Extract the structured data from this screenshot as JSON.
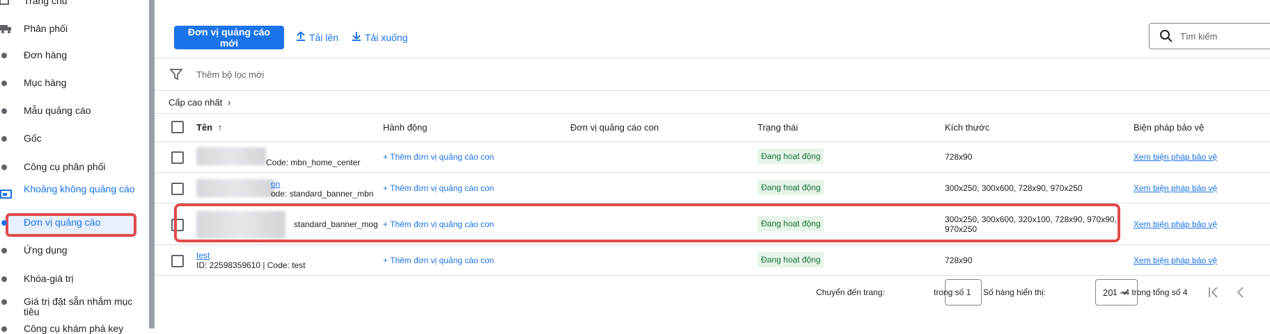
{
  "sidebar": {
    "items": [
      {
        "label": "Trang chủ",
        "icon": "home-icon"
      },
      {
        "label": "Phân phối",
        "icon": "truck-icon"
      },
      {
        "label": "Đơn hàng",
        "icon": "bullet-icon"
      },
      {
        "label": "Mục hàng",
        "icon": "bullet-icon"
      },
      {
        "label": "Mẫu quảng cáo",
        "icon": "bullet-icon"
      },
      {
        "label": "Gốc",
        "icon": "bullet-icon"
      },
      {
        "label": "Công cụ phân phối",
        "icon": "bullet-icon"
      },
      {
        "label": "Khoảng không quảng cáo",
        "icon": "inventory-icon"
      },
      {
        "label": "Đơn vị quảng cáo",
        "icon": "bullet-icon"
      },
      {
        "label": "Ứng dụng",
        "icon": "bullet-icon"
      },
      {
        "label": "Khóa-giá trị",
        "icon": "bullet-icon"
      },
      {
        "label": "Giá trị đặt sẵn nhắm mục tiêu",
        "icon": "bullet-icon"
      },
      {
        "label": "Công cụ khám phá key",
        "icon": "bullet-icon"
      }
    ]
  },
  "toolbar": {
    "new_label": "Đơn vị quảng cáo mới",
    "upload_label": "Tải lên",
    "download_label": "Tải xuống",
    "search_placeholder": "Tìm kiếm"
  },
  "filter": {
    "placeholder": "Thêm bộ lọc mới"
  },
  "breadcrumb": {
    "label": "Cấp cao nhất"
  },
  "table": {
    "headers": [
      "Tên",
      "Hành động",
      "Đơn vị quảng cáo con",
      "Trạng thái",
      "Kích thước",
      "Biện pháp bảo vệ"
    ],
    "rows": [
      {
        "name_detail": "Code: mbn_home_center",
        "action": "+ Thêm đơn vị quảng cáo con",
        "status": "Đang hoạt động",
        "sizes": "728x90",
        "protection": "Xem biện pháp bảo vệ"
      },
      {
        "name_link_tail": "on",
        "name_detail": "ode: standard_banner_mbn",
        "action": "+ Thêm đơn vị quảng cáo con",
        "status": "Đang hoạt động",
        "sizes": "300x250, 300x600, 728x90, 970x250",
        "protection": "Xem biện pháp bảo vệ"
      },
      {
        "name_detail": "standard_banner_mog",
        "action": "+ Thêm đơn vị quảng cáo con",
        "status": "Đang hoạt động",
        "sizes_line1": "300x250, 300x600, 320x100, 728x90, 970x90,",
        "sizes_line2": "970x250",
        "protection": "Xem biện pháp bảo vệ"
      },
      {
        "name": "test",
        "name_detail": "ID: 22598359610 | Code: test",
        "action": "+ Thêm đơn vị quảng cáo con",
        "status": "Đang hoạt động",
        "sizes": "728x90",
        "protection": "Xem biện pháp bảo vệ"
      }
    ]
  },
  "pagination": {
    "goto_label": "Chuyển đến trang:",
    "of_label": "trong số 1",
    "rows_label": "Số hàng hiển thị:",
    "rows_value": "20",
    "range_label": "1 - 4 trong tổng số 4"
  },
  "colors": {
    "accent": "#1a73e8",
    "highlight": "#e04a4a",
    "status_bg": "#e6f4ea",
    "status_fg": "#137333"
  }
}
